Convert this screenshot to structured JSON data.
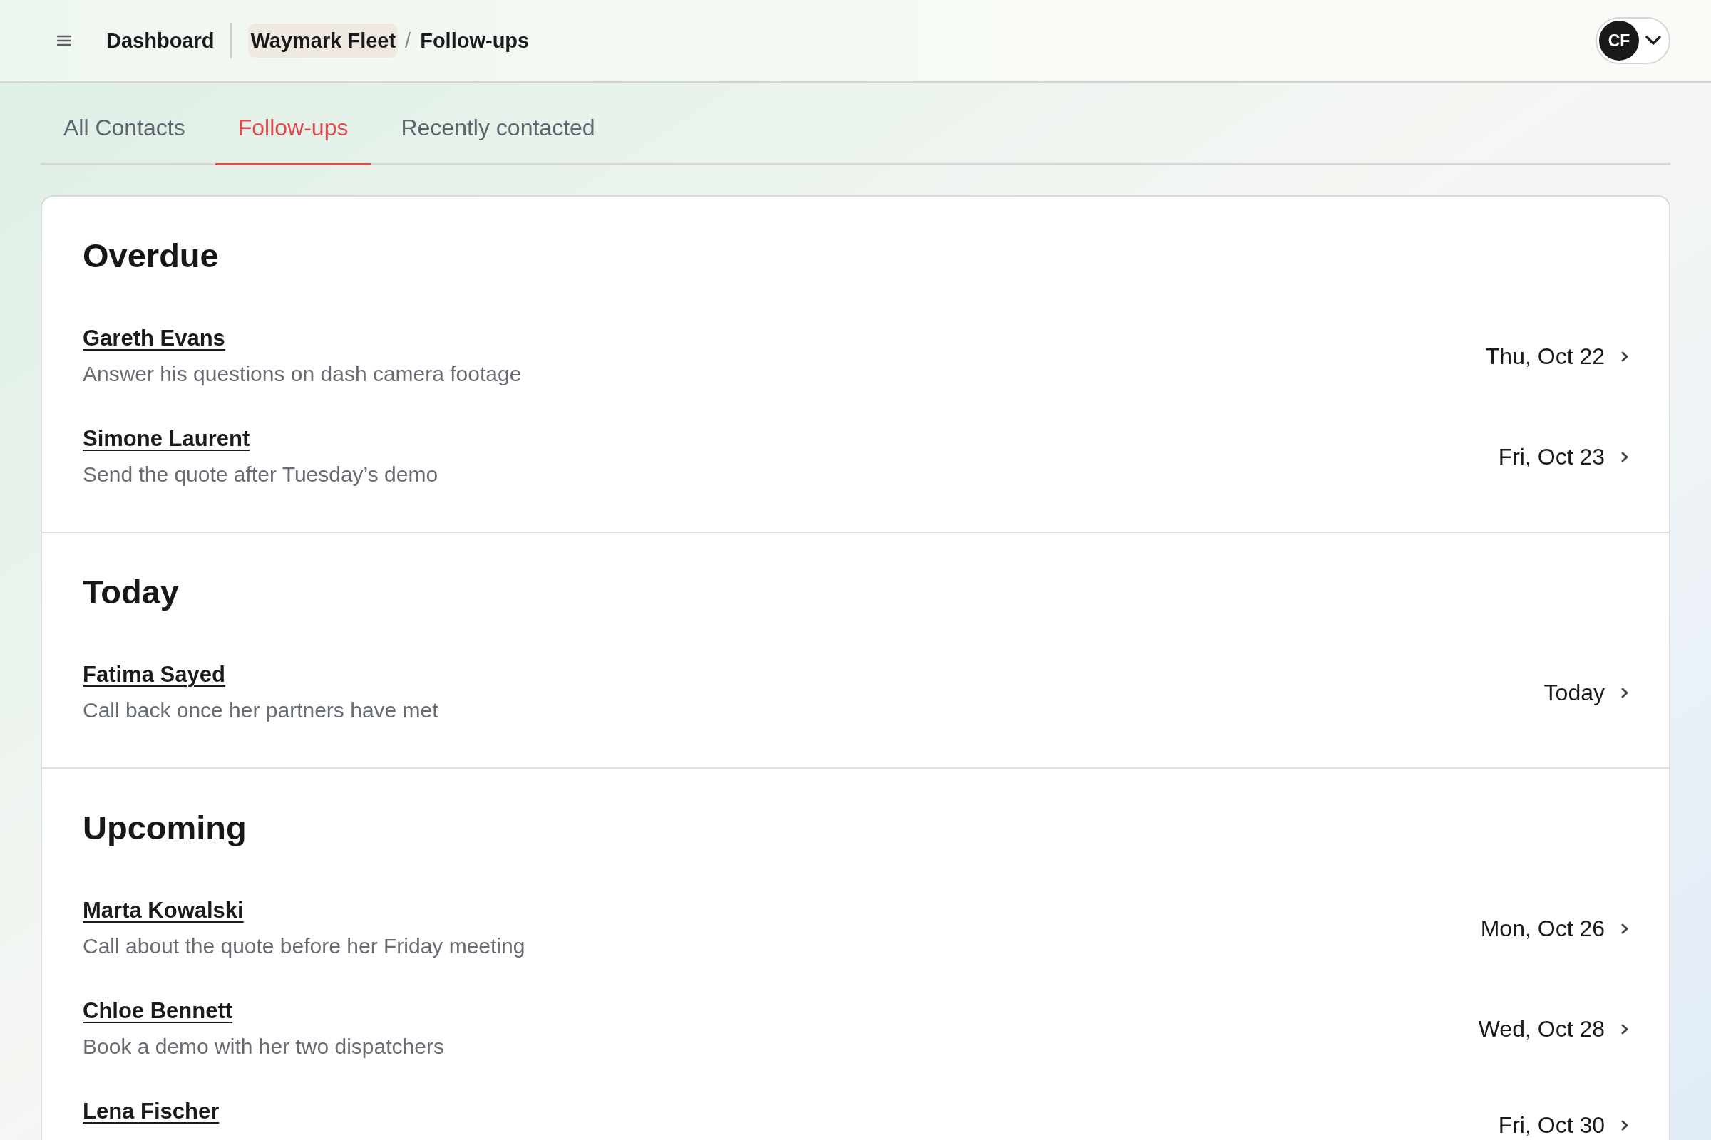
{
  "header": {
    "home_link": "Dashboard",
    "breadcrumbs": [
      {
        "label": "Waymark Fleet",
        "highlighted": true
      },
      {
        "label": "Follow-ups",
        "highlighted": false
      }
    ],
    "breadcrumb_separator": "/",
    "user": {
      "initials": "CF"
    }
  },
  "tabs": [
    {
      "label": "All Contacts",
      "selected": false
    },
    {
      "label": "Follow-ups",
      "selected": true
    },
    {
      "label": "Recently contacted",
      "selected": false
    }
  ],
  "sections": [
    {
      "title": "Overdue",
      "items": [
        {
          "name": "Gareth Evans",
          "note": "Answer his questions on dash camera footage",
          "due": "Thu, Oct 22"
        },
        {
          "name": "Simone Laurent",
          "note": "Send the quote after Tuesday’s demo",
          "due": "Fri, Oct 23"
        }
      ]
    },
    {
      "title": "Today",
      "items": [
        {
          "name": "Fatima Sayed",
          "note": "Call back once her partners have met",
          "due": "Today"
        }
      ]
    },
    {
      "title": "Upcoming",
      "items": [
        {
          "name": "Marta Kowalski",
          "note": "Call about the quote before her Friday meeting",
          "due": "Mon, Oct 26"
        },
        {
          "name": "Chloe Bennett",
          "note": "Book a demo with her two dispatchers",
          "due": "Wed, Oct 28"
        },
        {
          "name": "Lena Fischer",
          "due": "Fri, Oct 30"
        }
      ]
    }
  ]
}
